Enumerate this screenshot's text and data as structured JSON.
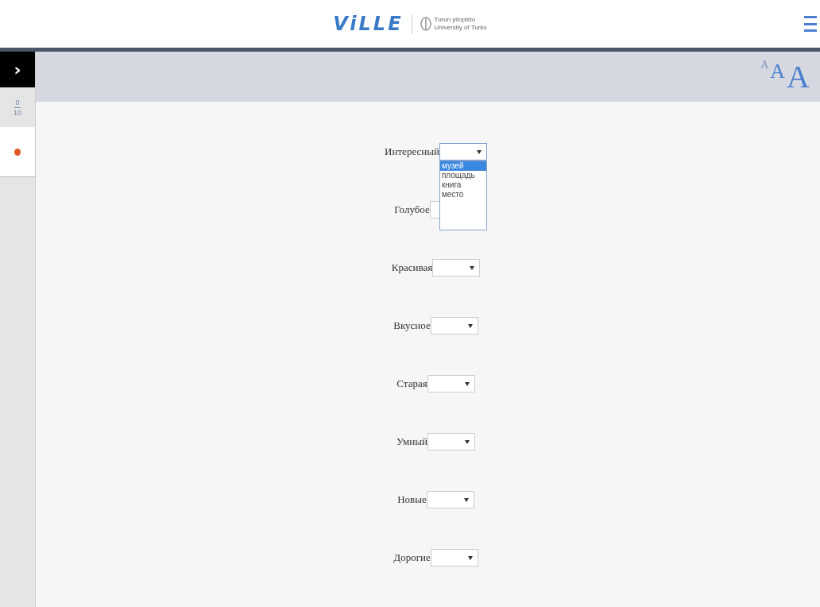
{
  "header": {
    "logo": "ViLLE",
    "university_fi": "Turun yliopisto",
    "university_en": "University of Turku"
  },
  "font_sizes": [
    {
      "label": "A",
      "kind": "small"
    },
    {
      "label": "A",
      "kind": "medium"
    },
    {
      "label": "A",
      "kind": "large"
    }
  ],
  "sidebar": {
    "toggle": "›",
    "score": "0",
    "total": "10",
    "tasks": [
      {
        "color": "#e0582a"
      }
    ]
  },
  "questions": [
    {
      "label": "Интересный",
      "expanded": true,
      "options": [
        {
          "label": "музей",
          "selected": true
        },
        {
          "label": "площадь",
          "selected": false
        },
        {
          "label": "книга",
          "selected": false
        },
        {
          "label": "место",
          "selected": false
        }
      ]
    },
    {
      "label": "Голубое",
      "expanded": false
    },
    {
      "label": "Красивая",
      "expanded": false
    },
    {
      "label": "Вкусное",
      "expanded": false
    },
    {
      "label": "Старая",
      "expanded": false
    },
    {
      "label": "Умный",
      "expanded": false
    },
    {
      "label": "Новые",
      "expanded": false
    },
    {
      "label": "Дорогие",
      "expanded": false
    }
  ]
}
